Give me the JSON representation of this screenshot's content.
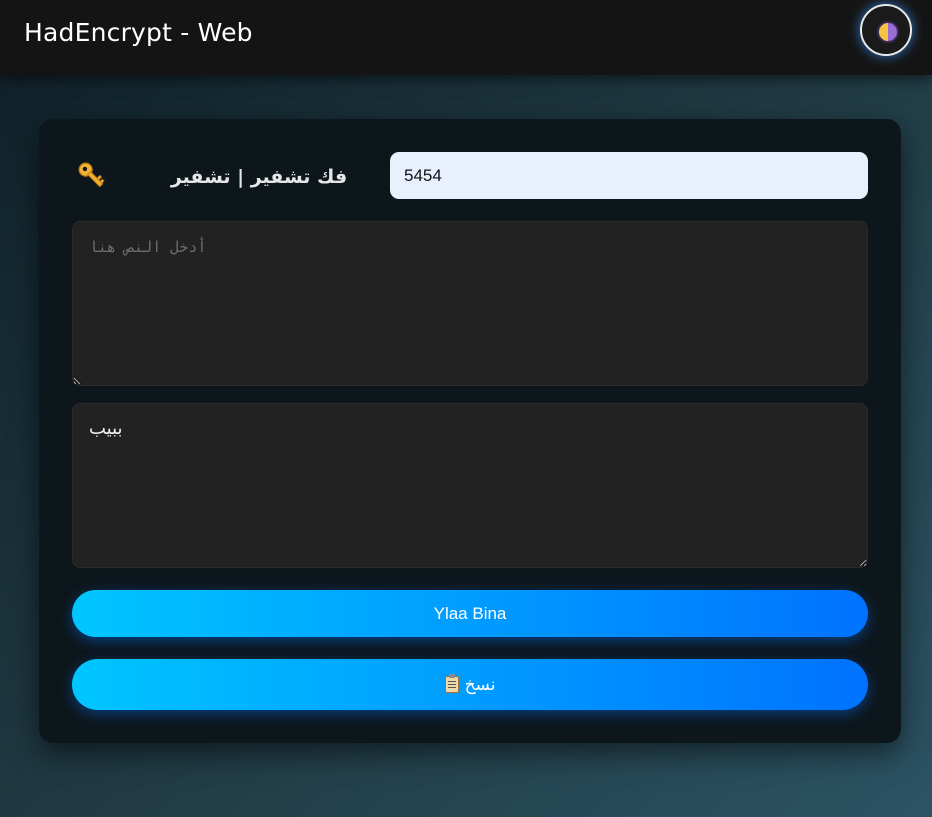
{
  "header": {
    "title": "HadEncrypt - Web",
    "theme_toggle_icon": "half-moon-icon"
  },
  "form": {
    "key_icon": "key-icon",
    "mode_label": "فك تشفير | تشفير",
    "key_value": "5454",
    "input_placeholder": "أدخل النص هنا",
    "input_value": "",
    "output_value": "ببيب",
    "run_button_label": "Ylaa Bina",
    "copy_button_label": "نسخ",
    "copy_icon": "clipboard-icon"
  },
  "colors": {
    "accent_start": "#00c6ff",
    "accent_end": "#0072ff",
    "key_field_bg": "#e8f0fe",
    "card_bg": "#0d161b"
  }
}
